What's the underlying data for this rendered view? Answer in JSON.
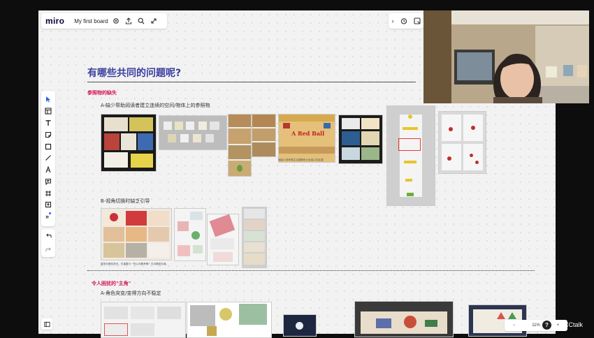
{
  "app": {
    "logo": "miro",
    "board_name": "My first board"
  },
  "topbar_icons": [
    "settings-icon",
    "share-upload-icon",
    "search-icon",
    "integrations-icon"
  ],
  "rightbar": {
    "collapse": "›",
    "icons": [
      "timer-icon",
      "reactions-icon"
    ]
  },
  "toolbar_tools": [
    "select-cursor",
    "templates",
    "text",
    "sticky-note",
    "shape",
    "line",
    "pen",
    "comment",
    "frame",
    "upload",
    "more-tools"
  ],
  "content": {
    "title": "有哪些共同的问题呢?",
    "section1": {
      "heading": "参照物的缺失",
      "sub_a": "A-缺少帮助阅读者建立连续的空间/物体上的参照物",
      "caption_redball": "固绘少参考周生活感解来大全金以坑此甚",
      "sub_b": "B-视角切换时缺乏引导",
      "caption_b": "重型对照检进页，在重要与一些以对要考情？引向确显存道。"
    },
    "section2": {
      "heading": "令人困扰的\"主角\"",
      "sub_a": "A-角色突变/变得方向不稳定"
    },
    "redball_text": "A Red Ball"
  },
  "zoom": {
    "minus": "−",
    "level": "11%",
    "plus": "+"
  },
  "help": "?",
  "watermark": "CCtalk",
  "colors": {
    "title": "#3a3f9e",
    "accent_red": "#d4145a",
    "board_bg": "#f2f2f2"
  }
}
